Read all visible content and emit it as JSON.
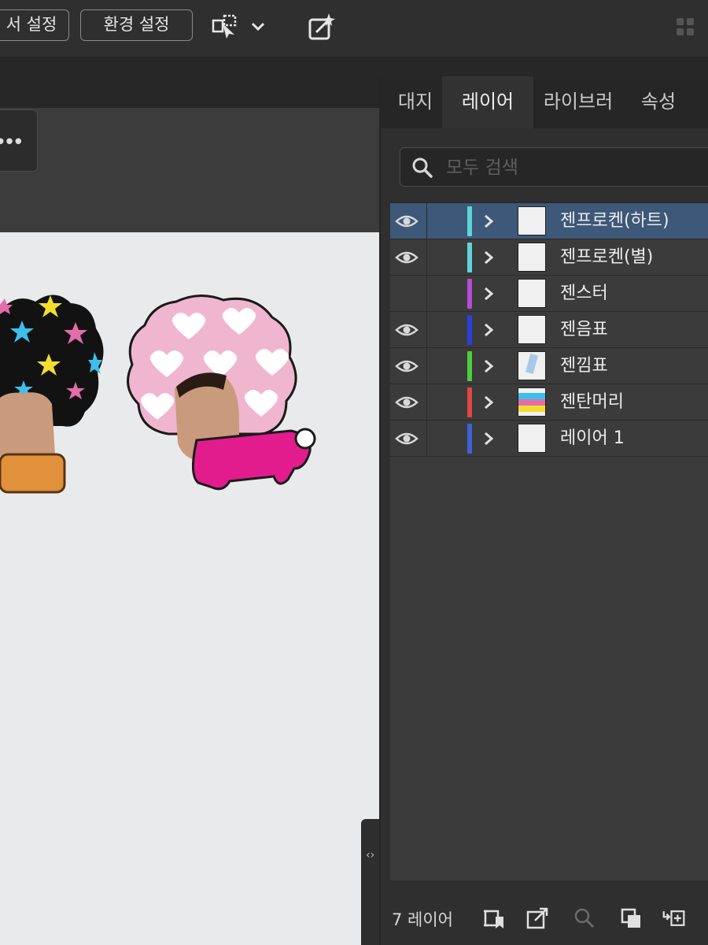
{
  "toolbar": {
    "doc_settings_label": "서 설정",
    "preferences_label": "환경 설정",
    "arrange_icon": "arrange-artboard-icon",
    "dropdown_icon": "chevron-down-icon",
    "export_icon": "export-share-icon",
    "grid_icon": "grid-dots-icon"
  },
  "canvas": {
    "more_widget": "•••",
    "side_collapse": "‹›"
  },
  "panel": {
    "tabs": [
      {
        "label": "대지",
        "active": false
      },
      {
        "label": "레이어",
        "active": true
      },
      {
        "label": "라이브러",
        "active": false
      },
      {
        "label": "속성",
        "active": false
      }
    ],
    "search_placeholder": "모두 검색",
    "layers": [
      {
        "name": "젠프로켄(하트)",
        "visible": true,
        "color": "#5fd4d8",
        "selected": true
      },
      {
        "name": "젠프로켄(별)",
        "visible": true,
        "color": "#5fd4d8",
        "selected": false
      },
      {
        "name": "젠스터",
        "visible": false,
        "color": "#b74bd6",
        "selected": false
      },
      {
        "name": "젠음표",
        "visible": true,
        "color": "#2a3fe0",
        "selected": false
      },
      {
        "name": "젠낌표",
        "visible": true,
        "color": "#4ccf3e",
        "selected": false
      },
      {
        "name": "젠탄머리",
        "visible": true,
        "color": "#e04646",
        "selected": false
      },
      {
        "name": "레이어 1",
        "visible": true,
        "color": "#3f62d8",
        "selected": false
      }
    ],
    "layer_count_label": "7 레이어",
    "footer_icons": [
      "collect-export-icon",
      "export-icon",
      "locate-object-icon",
      "make-clipping-mask-icon",
      "new-sublayer-icon"
    ]
  }
}
